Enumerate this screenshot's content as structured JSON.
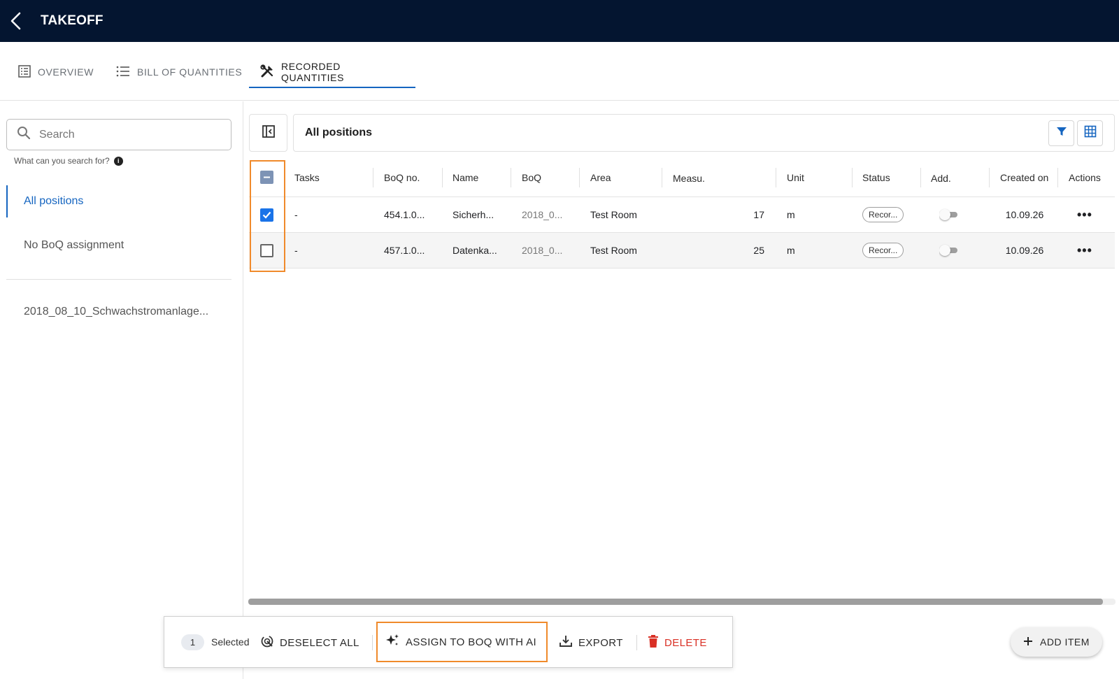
{
  "app": {
    "title": "TAKEOFF"
  },
  "tabs": [
    {
      "label": "OVERVIEW",
      "icon": "list-box-icon",
      "active": false
    },
    {
      "label": "BILL OF QUANTITIES",
      "icon": "list-icon",
      "active": false
    },
    {
      "label": "RECORDED QUANTITIES",
      "icon": "tools-icon",
      "active": true
    }
  ],
  "sidebar": {
    "search": {
      "placeholder": "Search",
      "hint": "What can you search for?"
    },
    "items": [
      {
        "label": "All positions",
        "active": true
      },
      {
        "label": "No BoQ assignment",
        "active": false
      },
      {
        "label": "2018_08_10_Schwachstromanlage..."
      }
    ]
  },
  "content": {
    "title": "All positions"
  },
  "table": {
    "columns": [
      "Tasks",
      "BoQ no.",
      "Name",
      "BoQ",
      "Area",
      "Measu.",
      "Unit",
      "Status",
      "Add.",
      "Created on",
      "Actions"
    ],
    "rows": [
      {
        "selected": true,
        "tasks": "-",
        "boq_no": "454.1.0...",
        "name": "Sicherh...",
        "boq": "2018_0...",
        "area": "Test Room",
        "measure": "17",
        "unit": "m",
        "status": "Recor...",
        "add": false,
        "created": "10.09.26",
        "actions": "•••"
      },
      {
        "selected": false,
        "tasks": "-",
        "boq_no": "457.1.0...",
        "name": "Datenka...",
        "boq": "2018_0...",
        "area": "Test Room",
        "measure": "25",
        "unit": "m",
        "status": "Recor...",
        "add": false,
        "created": "10.09.26",
        "actions": "•••"
      }
    ]
  },
  "selection_bar": {
    "count": "1",
    "selected_label": "Selected",
    "deselect_all": "DESELECT ALL",
    "assign_ai": "ASSIGN TO BOQ WITH AI",
    "export": "EXPORT",
    "delete": "DELETE"
  },
  "add_item": "ADD ITEM",
  "colors": {
    "topbar": "#041530",
    "accent": "#1565c0",
    "checkbox": "#1a73e8",
    "highlight": "#f08a2b",
    "danger": "#d93025"
  }
}
